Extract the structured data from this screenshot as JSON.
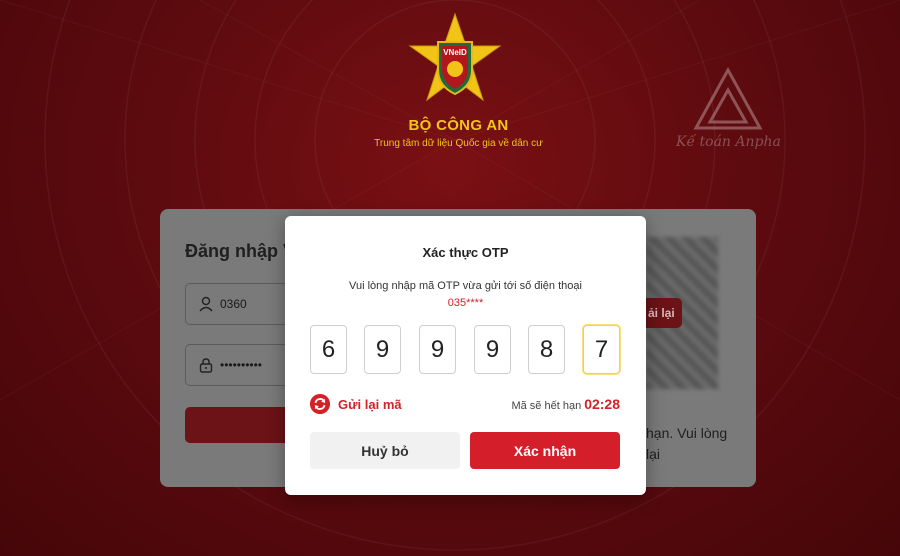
{
  "header": {
    "emblem_text": "VNeID",
    "org_name": "BỘ CÔNG AN",
    "org_subtitle": "Trung tâm dữ liệu Quốc gia về dân cư"
  },
  "watermark": {
    "text": "Kế toán Anpha"
  },
  "login": {
    "title": "Đăng nhập V",
    "username_value": "0360",
    "password_value": "••••••••••",
    "retry_label": "ải lại",
    "hint_line1": "hạn. Vui lòng",
    "hint_line2": "lại"
  },
  "otp_modal": {
    "title": "Xác thực OTP",
    "instruction": "Vui lòng nhập mã OTP vừa gửi tới số điện thoại",
    "phone_masked": "035****",
    "digits": [
      "6",
      "9",
      "9",
      "9",
      "8",
      "7"
    ],
    "resend_label": "Gửi lại mã",
    "expiry_label": "Mã sẽ hết hạn",
    "expiry_time": "02:28",
    "cancel_label": "Huỷ bỏ",
    "confirm_label": "Xác nhận"
  },
  "colors": {
    "background": "#5e0b0f",
    "accent_red": "#d41f2a",
    "gold": "#f2c418"
  }
}
